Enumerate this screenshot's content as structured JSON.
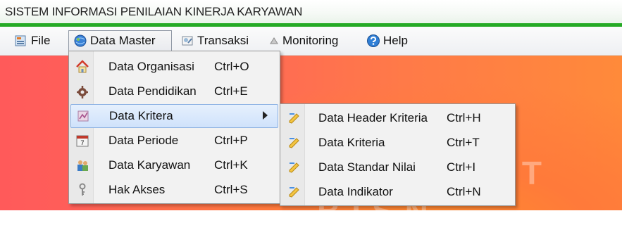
{
  "window": {
    "title": "SISTEM INFORMASI PENILAIAN KINERJA KARYAWAN"
  },
  "menubar": {
    "items": [
      {
        "label": "File",
        "icon": "file-icon"
      },
      {
        "label": "Data Master",
        "icon": "globe-icon",
        "active": true
      },
      {
        "label": "Transaksi",
        "icon": "transaksi-icon"
      },
      {
        "label": "Monitoring",
        "icon": "monitoring-icon"
      },
      {
        "label": "Help",
        "icon": "help-icon"
      }
    ]
  },
  "data_master_menu": [
    {
      "label": "Data Organisasi",
      "shortcut": "Ctrl+O",
      "icon": "house-icon"
    },
    {
      "label": "Data Pendidikan",
      "shortcut": "Ctrl+E",
      "icon": "gear-icon"
    },
    {
      "label": "Data Kritera",
      "shortcut": "",
      "icon": "chart-icon",
      "submenu": true,
      "highlighted": true
    },
    {
      "label": "Data Periode",
      "shortcut": "Ctrl+P",
      "icon": "calendar-icon"
    },
    {
      "label": "Data Karyawan",
      "shortcut": "Ctrl+K",
      "icon": "people-icon"
    },
    {
      "label": "Hak Akses",
      "shortcut": "Ctrl+S",
      "icon": "key-icon"
    }
  ],
  "kritera_submenu": [
    {
      "label": "Data Header Kriteria",
      "shortcut": "Ctrl+H",
      "icon": "pencil-icon"
    },
    {
      "label": "Data Kriteria",
      "shortcut": "Ctrl+T",
      "icon": "pencil-icon"
    },
    {
      "label": "Data Standar Nilai",
      "shortcut": "Ctrl+I",
      "icon": "pencil-icon"
    },
    {
      "label": "Data Indikator",
      "shortcut": "Ctrl+N",
      "icon": "pencil-icon"
    }
  ],
  "background": {
    "watermark": "INSTITUT BISN"
  },
  "colors": {
    "titlebar_accent": "#2fb52f",
    "highlight": "#cfe2fb",
    "canvas": "#ff6a4f"
  }
}
